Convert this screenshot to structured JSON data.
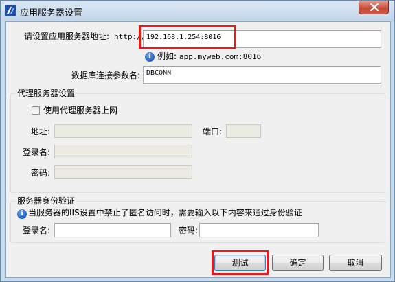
{
  "window": {
    "title": "应用服务器设置",
    "close_label": "✕"
  },
  "server": {
    "address_label": "请设置应用服务器地址:",
    "prefix": "http://",
    "address_value": "192.168.1.254:8016",
    "example_label": "例如:",
    "example_value": "app.myweb.com:8016",
    "db_param_label": "数据库连接参数名:",
    "db_param_value": "DBCONN"
  },
  "proxy": {
    "group_title": "代理服务器设置",
    "use_proxy_label": "使用代理服务器上网",
    "use_proxy_checked": false,
    "address_label": "地址:",
    "address_value": "",
    "port_label": "端口:",
    "port_value": "",
    "login_label": "登录名:",
    "login_value": "",
    "password_label": "密码:",
    "password_value": ""
  },
  "auth": {
    "group_title": "服务器身份验证",
    "info_text": "当服务器的IIS设置中禁止了匿名访问时，需要输入以下内容来通过身份验证",
    "login_label": "登录名:",
    "login_value": "",
    "password_label": "密码:",
    "password_value": ""
  },
  "buttons": {
    "test_label": "测试",
    "ok_label": "确定",
    "cancel_label": "取消"
  },
  "colors": {
    "highlight": "#e31b1b",
    "title_bar": "#c7dbee",
    "info_icon": "#1c5fc7"
  }
}
